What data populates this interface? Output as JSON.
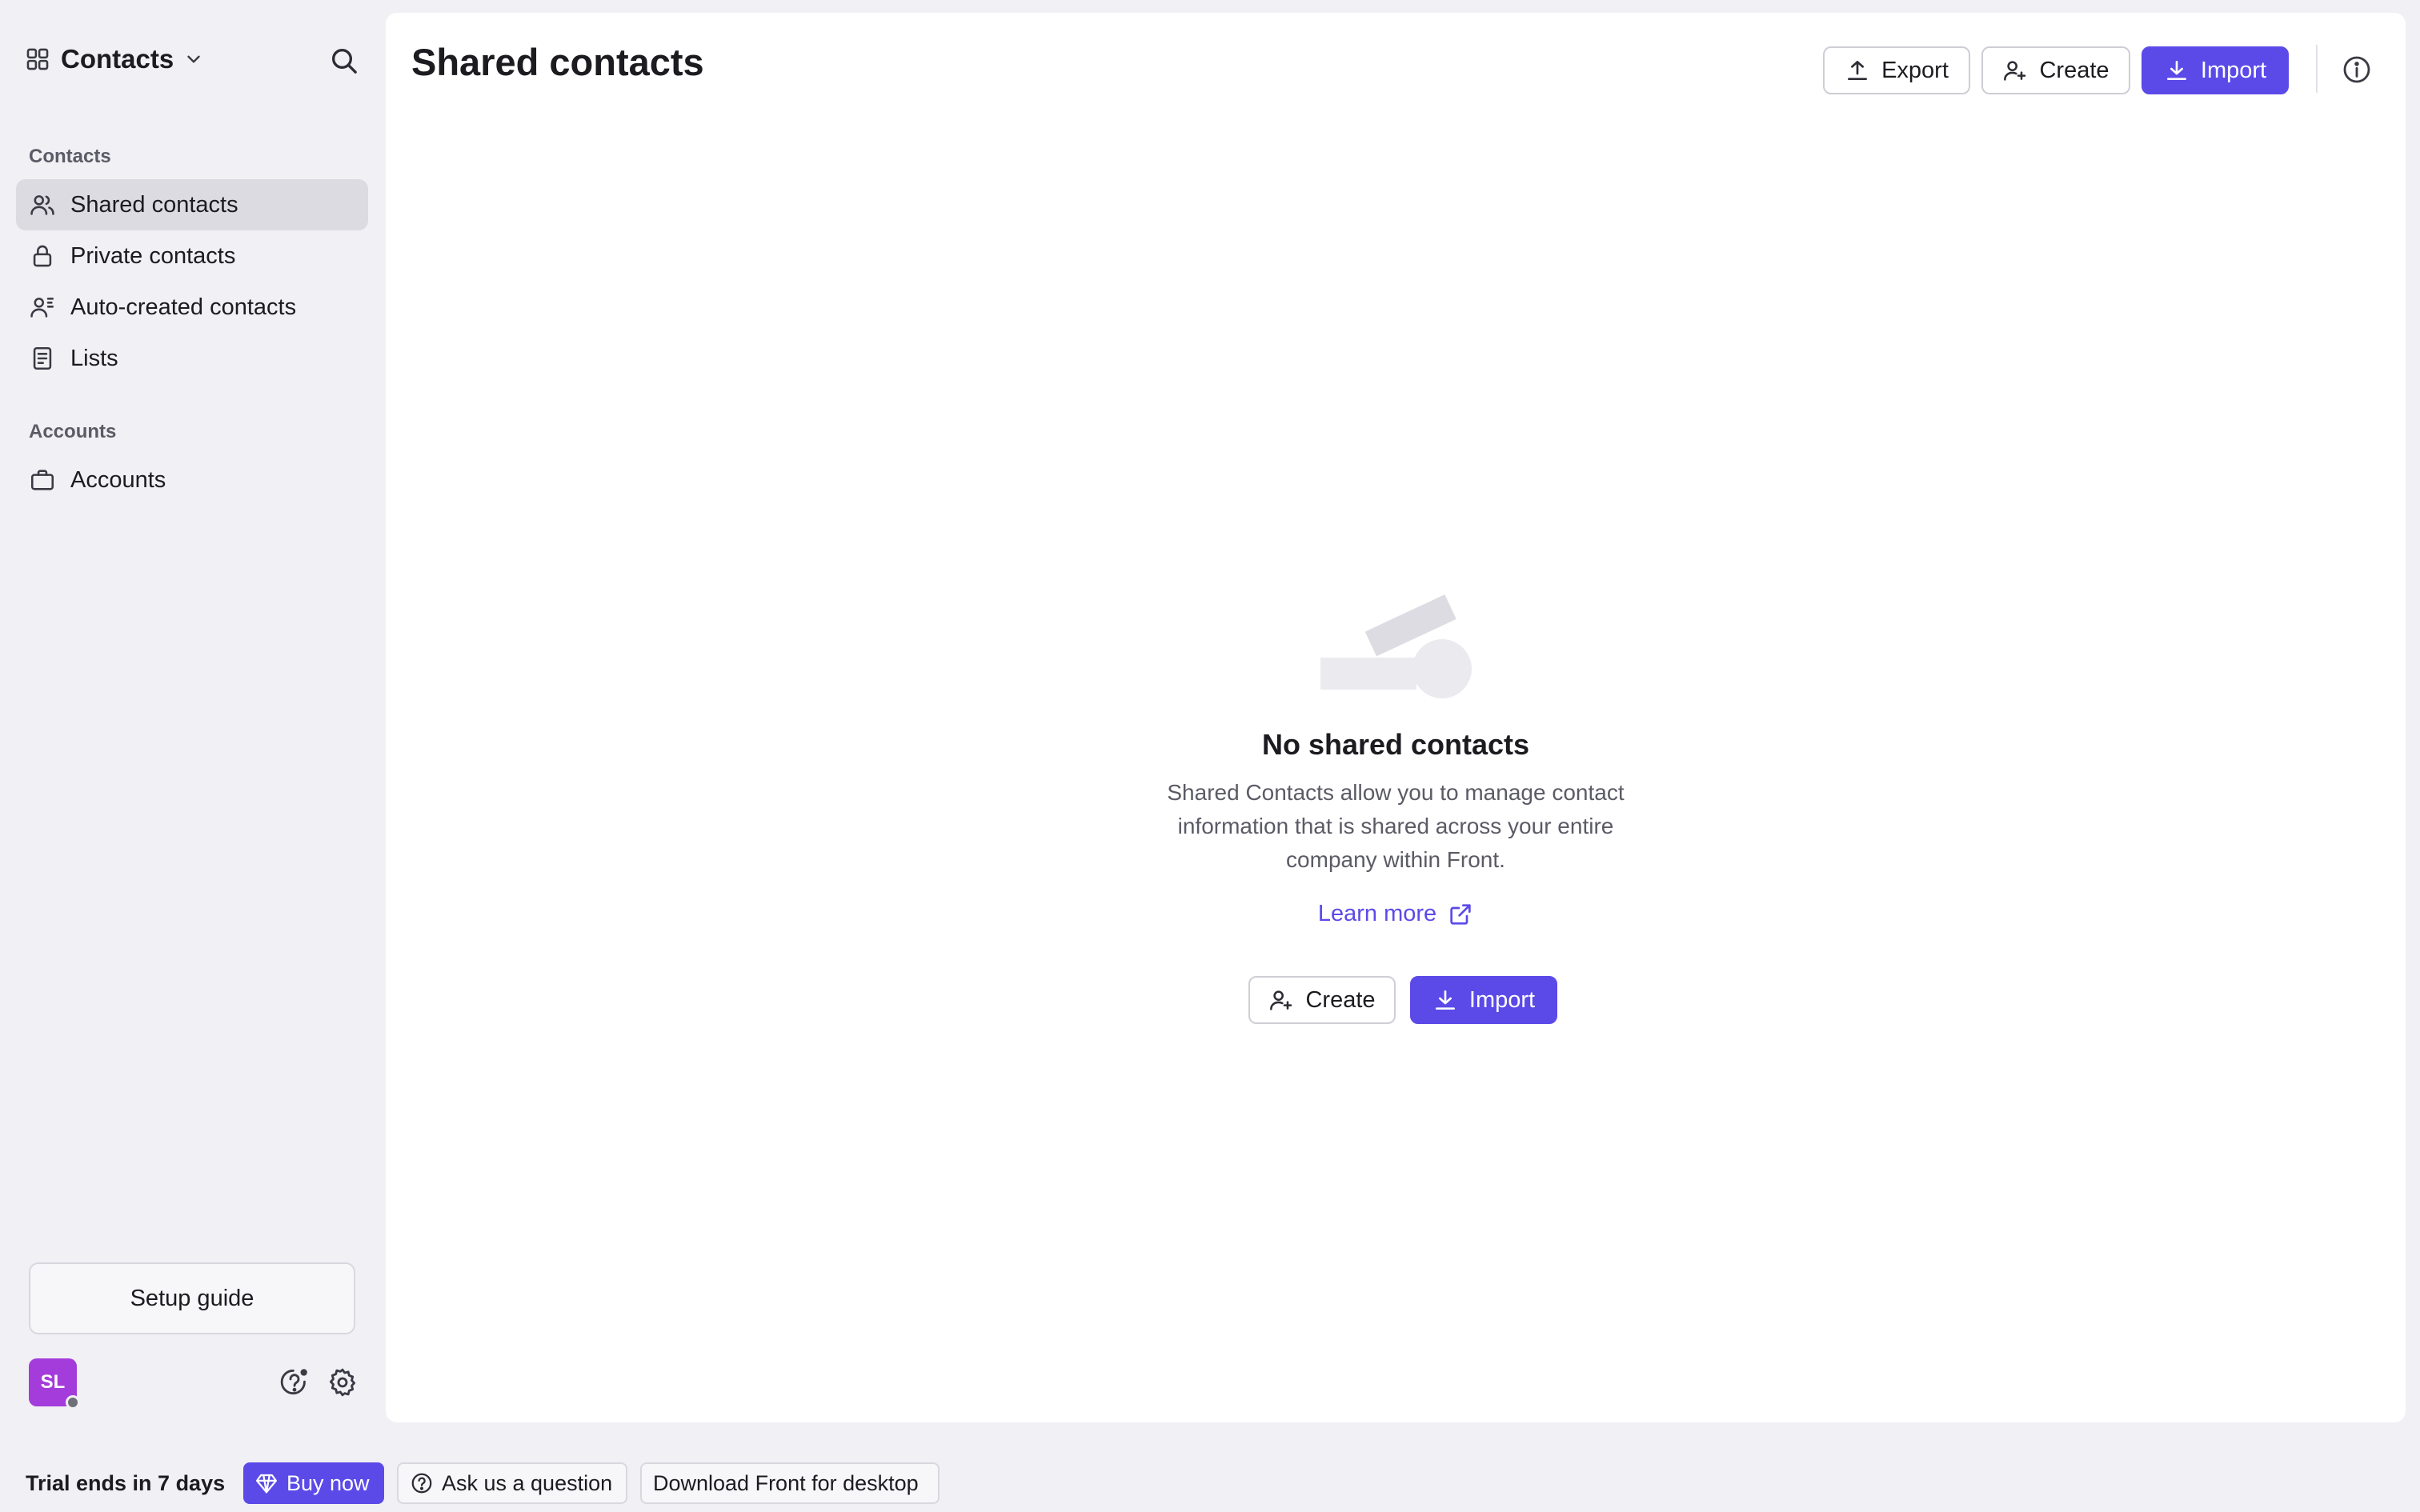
{
  "app": {
    "name": "Contacts",
    "switcher_icon": "grid-icon",
    "search_icon": "search-icon"
  },
  "sidebar": {
    "sections": [
      {
        "label": "Contacts",
        "items": [
          {
            "label": "Shared contacts",
            "icon": "users-icon",
            "active": true
          },
          {
            "label": "Private contacts",
            "icon": "lock-icon",
            "active": false
          },
          {
            "label": "Auto-created contacts",
            "icon": "user-auto-icon",
            "active": false
          },
          {
            "label": "Lists",
            "icon": "list-icon",
            "active": false
          }
        ]
      },
      {
        "label": "Accounts",
        "items": [
          {
            "label": "Accounts",
            "icon": "briefcase-icon",
            "active": false
          }
        ]
      }
    ],
    "setup_guide": "Setup guide",
    "user_initials": "SL"
  },
  "main": {
    "title": "Shared contacts",
    "toolbar": {
      "export_label": "Export",
      "create_label": "Create",
      "import_label": "Import"
    },
    "empty_state": {
      "title": "No shared contacts",
      "description": "Shared Contacts allow you to manage contact information that is shared across your entire company within Front.",
      "learn_more": "Learn more",
      "create_label": "Create",
      "import_label": "Import"
    }
  },
  "footer": {
    "trial_text": "Trial ends in 7 days",
    "buy_now": "Buy now",
    "ask_question": "Ask us a question",
    "download": "Download Front for desktop"
  },
  "colors": {
    "accent": "#5b4ae8",
    "sidebar_bg": "#f1f0f4",
    "active_item": "#dcdbe2",
    "avatar": "#a43bdb"
  }
}
